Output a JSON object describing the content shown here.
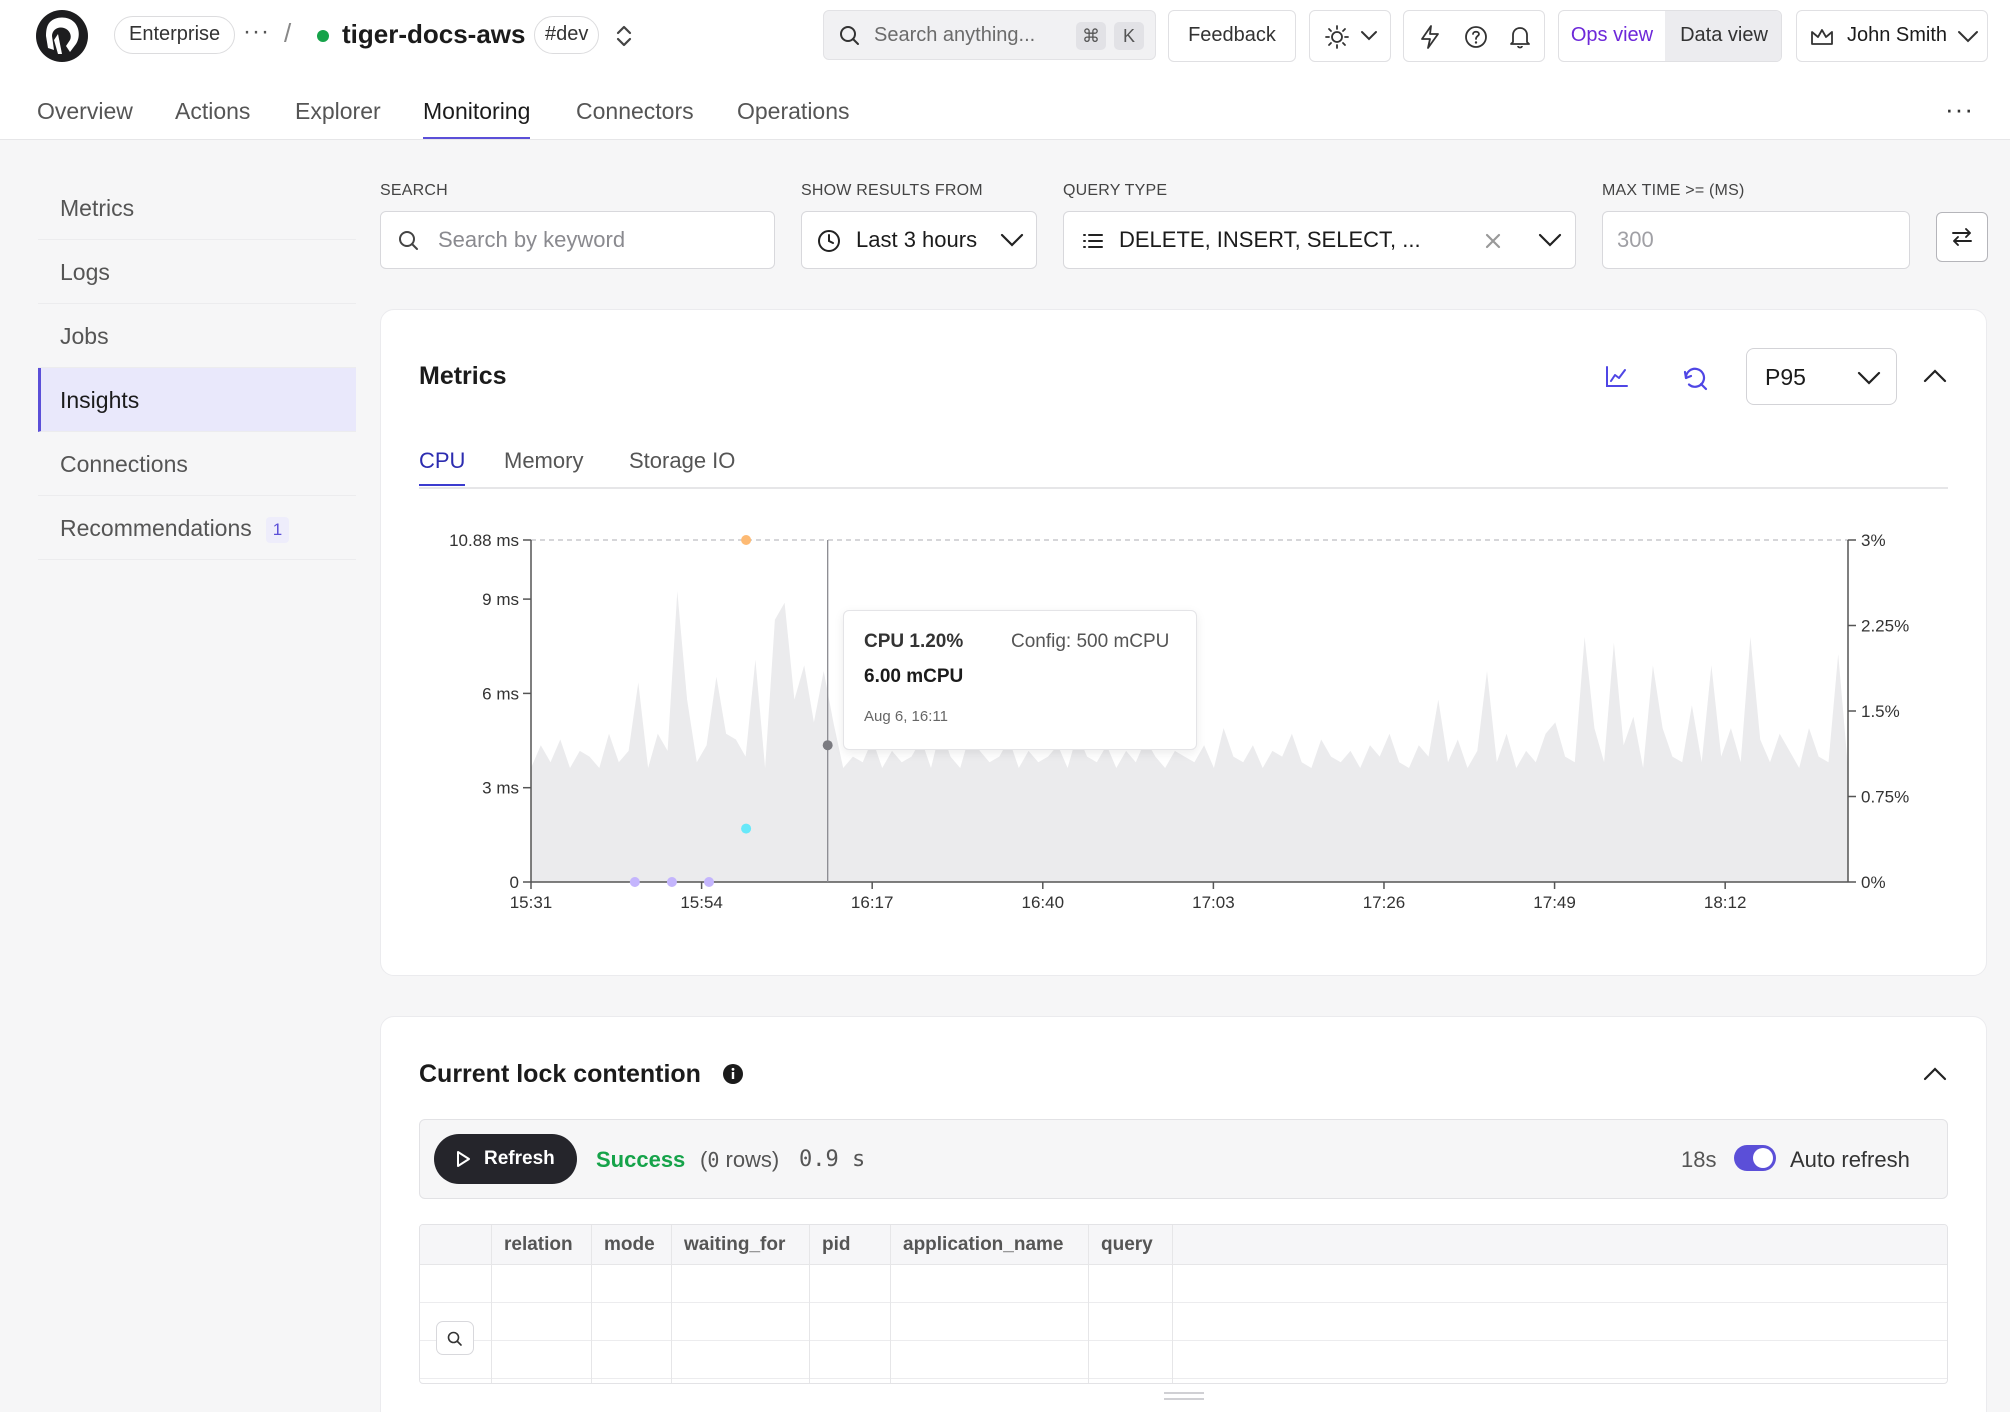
{
  "topbar": {
    "plan": "Enterprise",
    "more": "···",
    "separator": "/",
    "service_name": "tiger-docs-aws",
    "env_tag": "#dev",
    "search_placeholder": "Search anything...",
    "shortcut_cmd": "⌘",
    "shortcut_key": "K",
    "feedback": "Feedback",
    "ops_view": "Ops view",
    "data_view": "Data view",
    "user_name": "John Smith"
  },
  "nav": {
    "tabs": [
      "Overview",
      "Actions",
      "Explorer",
      "Monitoring",
      "Connectors",
      "Operations"
    ],
    "active": "Monitoring",
    "more": "···"
  },
  "sidebar": {
    "items": [
      {
        "label": "Metrics"
      },
      {
        "label": "Logs"
      },
      {
        "label": "Jobs"
      },
      {
        "label": "Insights"
      },
      {
        "label": "Connections"
      },
      {
        "label": "Recommendations",
        "badge": "1"
      }
    ],
    "active": "Insights"
  },
  "filters": {
    "search_label": "SEARCH",
    "search_placeholder": "Search by keyword",
    "show_from_label": "SHOW RESULTS FROM",
    "show_from_value": "Last 3 hours",
    "query_type_label": "QUERY TYPE",
    "query_type_value": "DELETE, INSERT, SELECT, ...",
    "max_time_label": "MAX TIME >= (MS)",
    "max_time_placeholder": "300"
  },
  "metrics": {
    "title": "Metrics",
    "percentile": "P95",
    "tabs": [
      "CPU",
      "Memory",
      "Storage IO"
    ],
    "active_tab": "CPU",
    "tooltip": {
      "cpu": "CPU 1.20%",
      "config": "Config: 500 mCPU",
      "mcpu": "6.00 mCPU",
      "time": "Aug 6, 16:11"
    }
  },
  "chart_data": {
    "type": "area",
    "x_labels": [
      "15:31",
      "15:54",
      "16:17",
      "16:40",
      "17:03",
      "17:26",
      "17:49",
      "18:12"
    ],
    "y_left_ticks": [
      "0",
      "3 ms",
      "6 ms",
      "9 ms",
      "10.88 ms"
    ],
    "y_left_values": [
      0,
      3,
      6,
      9,
      10.88
    ],
    "y_right_ticks": [
      "0%",
      "0.75%",
      "1.5%",
      "2.25%",
      "3%"
    ],
    "y_right_values": [
      0,
      0.75,
      1.5,
      2.25,
      3
    ],
    "ylim_left_ms": [
      0,
      10.88
    ],
    "ylim_right_pct": [
      0,
      3
    ],
    "baseline_pct": 1.0,
    "series": [
      {
        "values": [
          1.0,
          1.2,
          1.05,
          1.25,
          1.0,
          1.15,
          1.1,
          1.0,
          1.3,
          1.05,
          1.15,
          1.75,
          1.0,
          1.3,
          1.15,
          2.55,
          1.6,
          1.05,
          1.2,
          1.8,
          1.3,
          1.25,
          1.1,
          1.95,
          1.0,
          2.3,
          2.45,
          1.6,
          1.9,
          1.4,
          1.85,
          1.4,
          1.0,
          1.1,
          1.05,
          1.25,
          1.0,
          1.15,
          1.05,
          1.1,
          1.25,
          1.0,
          1.35,
          1.1,
          1.0,
          1.3,
          1.15,
          1.05,
          1.1,
          1.25,
          1.0,
          1.15,
          1.05,
          1.1,
          1.2,
          1.0,
          1.3,
          1.1,
          1.05,
          1.2,
          1.0,
          1.15,
          1.05,
          1.25,
          1.1,
          1.0,
          1.15,
          1.1,
          1.05,
          1.2,
          1.0,
          1.35,
          1.1,
          1.05,
          1.2,
          1.0,
          1.15,
          1.1,
          1.3,
          1.05,
          1.0,
          1.25,
          1.1,
          1.05,
          1.15,
          1.0,
          1.2,
          1.1,
          1.3,
          1.05,
          1.0,
          1.2,
          1.1,
          1.6,
          1.05,
          1.25,
          1.0,
          1.15,
          1.85,
          1.05,
          1.3,
          1.0,
          1.15,
          1.05,
          1.3,
          1.4,
          1.1,
          1.05,
          2.15,
          1.35,
          1.05,
          2.1,
          1.2,
          1.45,
          1.0,
          1.9,
          1.35,
          1.1,
          1.05,
          1.55,
          1.05,
          1.9,
          1.1,
          1.35,
          1.05,
          2.15,
          1.25,
          1.05,
          1.3,
          1.15,
          1.0,
          1.35,
          1.1,
          1.05,
          2.0,
          1.0
        ]
      }
    ],
    "hover_time": "16:11",
    "hover_pct": 1.2,
    "marker_points": [
      {
        "x": "15:45",
        "ms": 0,
        "color": "#c4b5fd"
      },
      {
        "x": "15:50",
        "ms": 0,
        "color": "#c4b5fd"
      },
      {
        "x": "15:55",
        "ms": 0,
        "color": "#c4b5fd"
      },
      {
        "x": "16:00",
        "ms": 1.7,
        "color": "#67e8f9"
      },
      {
        "x": "16:00",
        "ms": 10.88,
        "color": "#fdba74"
      }
    ]
  },
  "lock": {
    "title": "Current lock contention",
    "refresh": "Refresh",
    "status": "Success",
    "rows_open": "(",
    "rows_count": "0",
    "rows_close": " rows)",
    "duration": "0.9 s",
    "interval": "18s",
    "auto_refresh": "Auto refresh",
    "columns": [
      "relation",
      "mode",
      "waiting_for",
      "pid",
      "application_name",
      "query"
    ]
  },
  "colors": {
    "accent": "#5b4fd8",
    "success": "#16a34a",
    "chart_fill": "#ebebed"
  }
}
